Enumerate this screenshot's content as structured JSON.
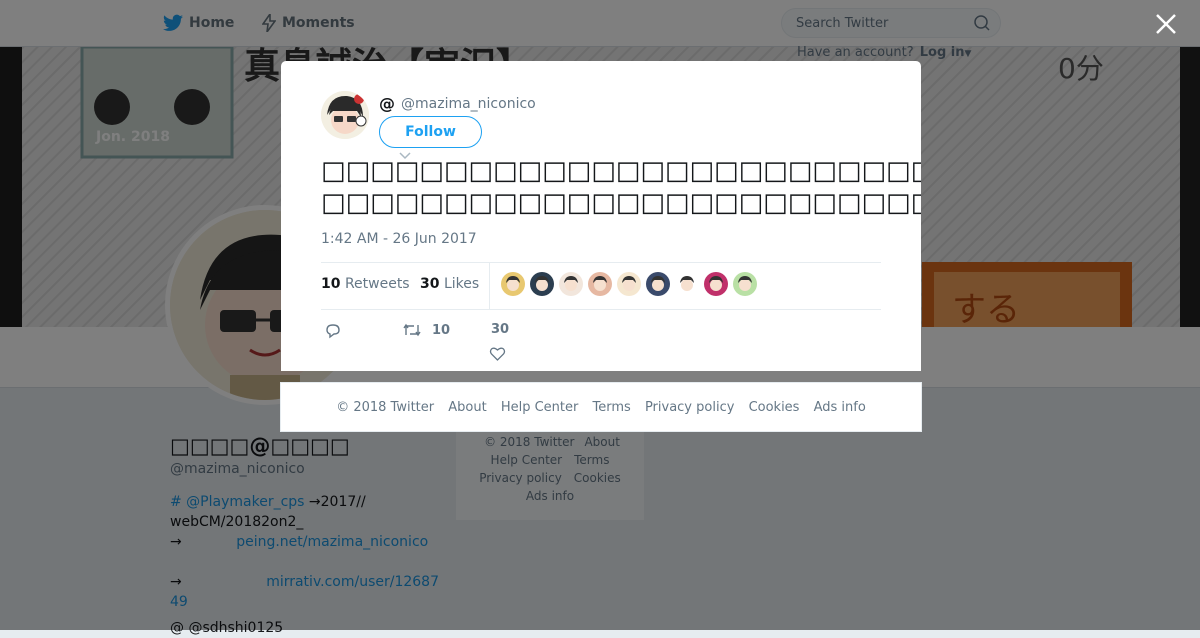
{
  "nav": {
    "home_label": "Home",
    "moments_label": "Moments",
    "search_placeholder": "Search Twitter",
    "have_account": "Have an account?",
    "login_label": "Log in"
  },
  "banner": {
    "title_text": "真島誠治【実況】",
    "minutes_text": "0分",
    "badge_text": "Jon. 2018",
    "button_text": "する"
  },
  "profile": {
    "name": "□□□□@□□□□",
    "handle": "@mazima_niconico",
    "bio_line1_link": "# @Playmaker_cps",
    "bio_line1_rest": " →2017//",
    "bio_line2": "webCM/20182on2_",
    "bio_line3_arrow": "→",
    "bio_line3_link": "peing.net/mazima_niconico",
    "bio_line4_arrow": "→",
    "bio_line4_link": "mirrativ.com/user/1268749",
    "bio_line5": "@ @sdhshi0125"
  },
  "bg_footer": {
    "copyright": "© 2018 Twitter",
    "about": "About",
    "help": "Help Center",
    "terms": "Terms",
    "privacy": "Privacy policy",
    "cookies": "Cookies",
    "ads": "Ads info"
  },
  "tweet": {
    "display_name": "@",
    "screen_name": "@mazima_niconico",
    "follow_label": "Follow",
    "text_line1": "□□□□□□□□□□□□□□□□□□□□□□□□□□□□□□□□□□□□□□□□□□□□←□□□□□□□□□",
    "text_line2": "□□□□□□□□□□□□□□□□□□□□□□□□□□□□□□□□□□□□□□□□□□□□←□□□□□□□□□",
    "timestamp": "1:42 AM - 26 Jun 2017",
    "retweets_count": "10",
    "retweets_label": "Retweets",
    "likes_count": "30",
    "likes_label": "Likes",
    "action_retweet_count": "10",
    "action_like_count": "30",
    "liker_colors": [
      "#e8c870",
      "#2c3e50",
      "#f2e6dc",
      "#e6b8a2",
      "#f5e7d0",
      "#3a4a6b",
      "#ffffff",
      "#c0306a",
      "#b9e0a5"
    ]
  },
  "modal_footer": {
    "copyright": "© 2018 Twitter",
    "about": "About",
    "help": "Help Center",
    "terms": "Terms",
    "privacy": "Privacy policy",
    "cookies": "Cookies",
    "ads": "Ads info"
  },
  "colors": {
    "accent": "#1da1f2",
    "link": "#1b95e0",
    "text": "#14171a",
    "muted": "#657786"
  }
}
